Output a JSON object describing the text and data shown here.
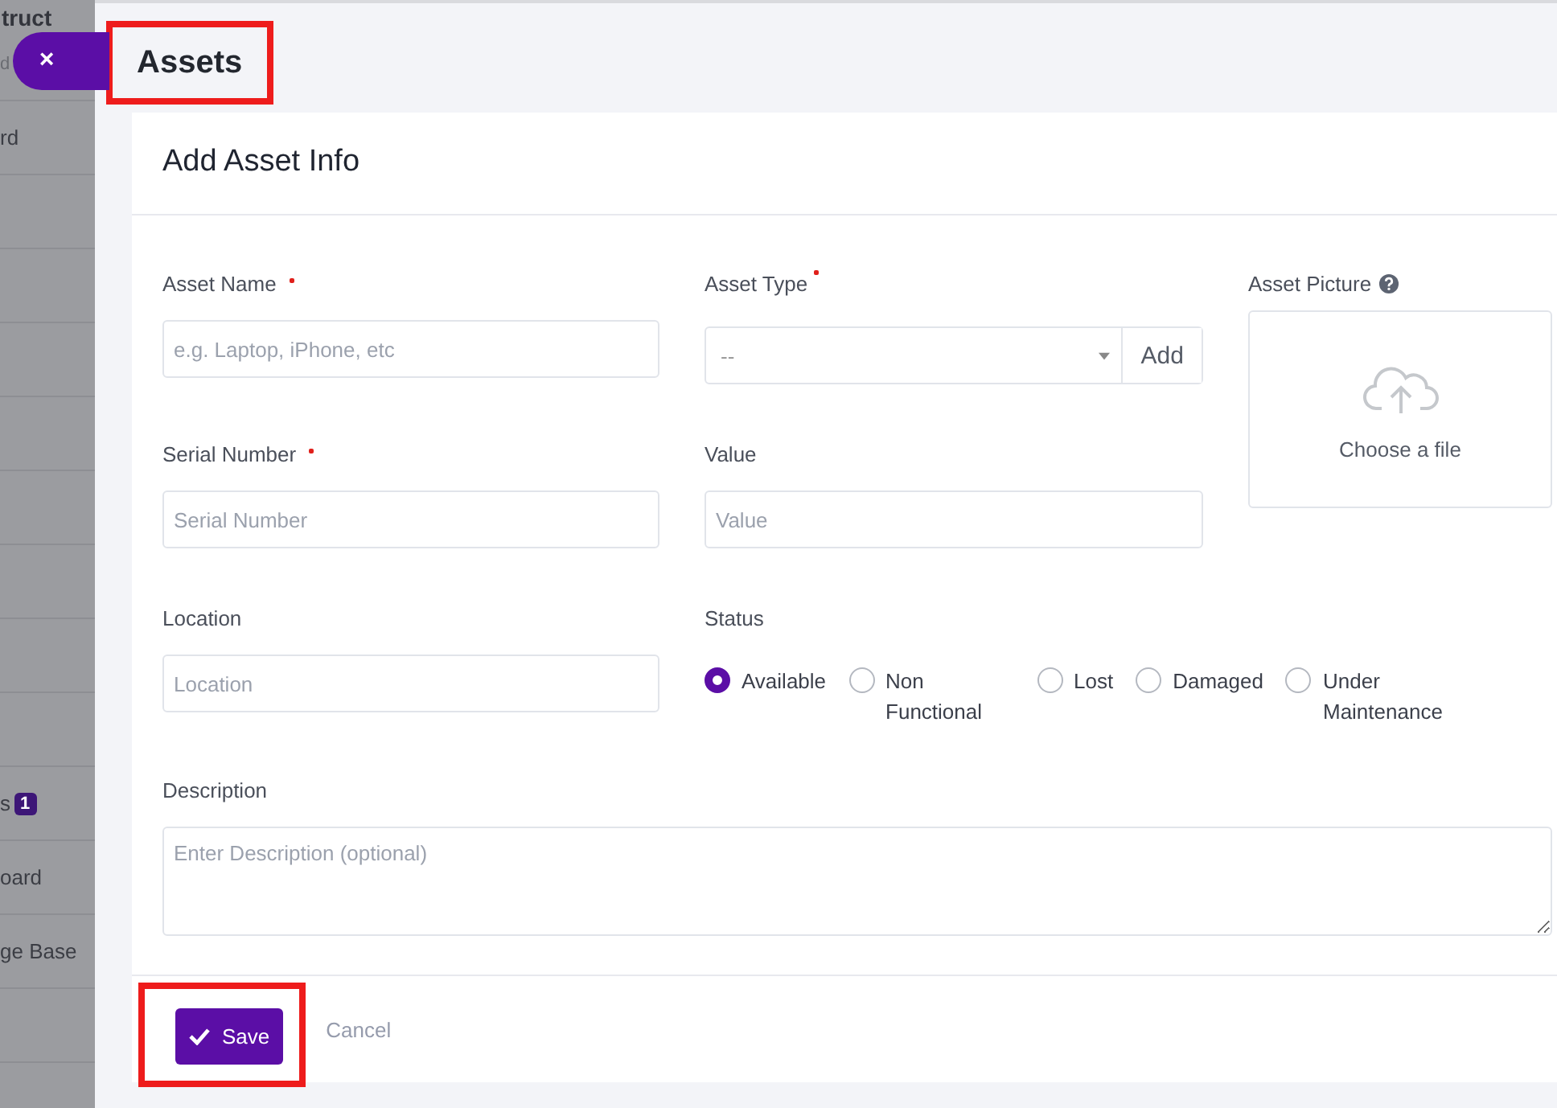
{
  "sidebar": {
    "header": {
      "title": "truct",
      "subtitle": "d"
    },
    "close_button": "×",
    "top_items": [
      {
        "label": "rd"
      }
    ],
    "bottom_items": [
      {
        "label": "s",
        "badge": "1"
      },
      {
        "label": "oard"
      },
      {
        "label": "ge Base"
      }
    ]
  },
  "page": {
    "title": "Assets",
    "highlighted": true
  },
  "card": {
    "title": "Add Asset Info",
    "fields": [
      {
        "kind": "text",
        "label": "Asset Name",
        "required": true,
        "placeholder": "e.g. Laptop, iPhone, etc"
      },
      {
        "kind": "select",
        "label": "Asset Type",
        "required": true,
        "value": "--",
        "add_button": "Add"
      },
      {
        "kind": "upload",
        "label": "Asset Picture",
        "prompt": "Choose a file"
      },
      {
        "kind": "text",
        "label": "Serial Number",
        "required": true,
        "placeholder": "Serial Number"
      },
      {
        "kind": "text",
        "label": "Value",
        "placeholder": "Value"
      },
      {
        "kind": "text",
        "label": "Location",
        "placeholder": "Location"
      },
      {
        "kind": "radio",
        "label": "Status",
        "options": [
          {
            "label": "Available",
            "selected": true
          },
          {
            "label": "Non Functional",
            "selected": false
          },
          {
            "label": "Lost",
            "selected": false
          },
          {
            "label": "Damaged",
            "selected": false
          },
          {
            "label": "Under Maintenance",
            "selected": false
          }
        ]
      },
      {
        "kind": "textarea",
        "label": "Description",
        "placeholder": "Enter Description (optional)"
      }
    ],
    "save_button": {
      "label": "Save",
      "highlighted": true
    },
    "cancel_link": "Cancel"
  }
}
